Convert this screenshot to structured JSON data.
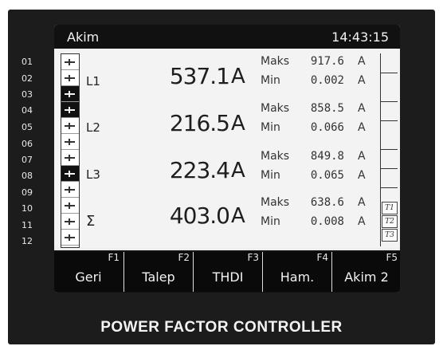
{
  "screen": {
    "title": "Akim",
    "clock": "14:43:15"
  },
  "step_numbers": [
    "01",
    "02",
    "03",
    "04",
    "05",
    "06",
    "07",
    "08",
    "09",
    "10",
    "11",
    "12"
  ],
  "steps_active": [
    false,
    false,
    true,
    true,
    false,
    false,
    false,
    true,
    false,
    false,
    false,
    false
  ],
  "phases": [
    {
      "name": "L1",
      "value": "537.1",
      "unit": "A",
      "max_label": "Maks",
      "max_value": "917.6",
      "max_unit": "A",
      "min_label": "Min",
      "min_value": "0.002",
      "min_unit": "A"
    },
    {
      "name": "L2",
      "value": "216.5",
      "unit": "A",
      "max_label": "Maks",
      "max_value": "858.5",
      "max_unit": "A",
      "min_label": "Min",
      "min_value": "0.066",
      "min_unit": "A"
    },
    {
      "name": "L3",
      "value": "223.4",
      "unit": "A",
      "max_label": "Maks",
      "max_value": "849.8",
      "max_unit": "A",
      "min_label": "Min",
      "min_value": "0.065",
      "min_unit": "A"
    },
    {
      "name": "Σ",
      "value": "403.0",
      "unit": "A",
      "max_label": "Maks",
      "max_value": "638.6",
      "max_unit": "A",
      "min_label": "Min",
      "min_value": "0.008",
      "min_unit": "A"
    }
  ],
  "transformers": [
    "T1",
    "T2",
    "T3"
  ],
  "function_keys": [
    {
      "key": "F1",
      "label": "Geri"
    },
    {
      "key": "F2",
      "label": "Talep"
    },
    {
      "key": "F3",
      "label": "THDI"
    },
    {
      "key": "F4",
      "label": "Ham."
    },
    {
      "key": "F5",
      "label": "Akim 2"
    }
  ],
  "brand": "POWER FACTOR CONTROLLER"
}
